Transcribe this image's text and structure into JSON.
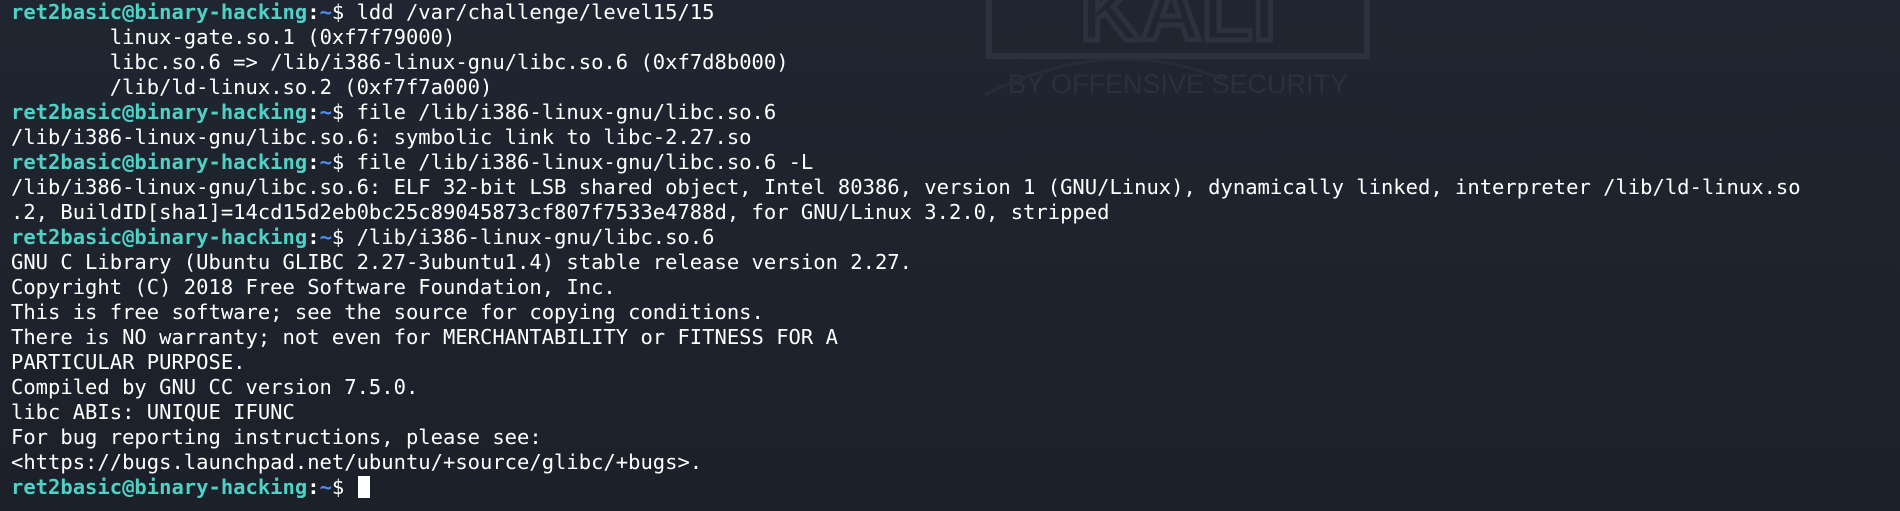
{
  "colors": {
    "background": "#1d222b",
    "prompt_userhost": "#4fd1c5",
    "prompt_path": "#4b8df0",
    "text": "#ffffff"
  },
  "watermark": {
    "logo_text": "KALI",
    "tagline": "BY OFFENSIVE SECURITY"
  },
  "prompt": {
    "userhost": "ret2basic@binary-hacking",
    "separator": ":",
    "path": "~",
    "sign": "$ "
  },
  "lines": [
    {
      "type": "prompt",
      "command": "ldd /var/challenge/level15/15"
    },
    {
      "type": "output",
      "text": "\tlinux-gate.so.1 (0xf7f79000)"
    },
    {
      "type": "output",
      "text": "\tlibc.so.6 => /lib/i386-linux-gnu/libc.so.6 (0xf7d8b000)"
    },
    {
      "type": "output",
      "text": "\t/lib/ld-linux.so.2 (0xf7f7a000)"
    },
    {
      "type": "prompt",
      "command": "file /lib/i386-linux-gnu/libc.so.6"
    },
    {
      "type": "output",
      "text": "/lib/i386-linux-gnu/libc.so.6: symbolic link to libc-2.27.so"
    },
    {
      "type": "prompt",
      "command": "file /lib/i386-linux-gnu/libc.so.6 -L"
    },
    {
      "type": "output",
      "text": "/lib/i386-linux-gnu/libc.so.6: ELF 32-bit LSB shared object, Intel 80386, version 1 (GNU/Linux), dynamically linked, interpreter /lib/ld-linux.so"
    },
    {
      "type": "output",
      "text": ".2, BuildID[sha1]=14cd15d2eb0bc25c89045873cf807f7533e4788d, for GNU/Linux 3.2.0, stripped"
    },
    {
      "type": "prompt",
      "command": "/lib/i386-linux-gnu/libc.so.6"
    },
    {
      "type": "output",
      "text": "GNU C Library (Ubuntu GLIBC 2.27-3ubuntu1.4) stable release version 2.27."
    },
    {
      "type": "output",
      "text": "Copyright (C) 2018 Free Software Foundation, Inc."
    },
    {
      "type": "output",
      "text": "This is free software; see the source for copying conditions."
    },
    {
      "type": "output",
      "text": "There is NO warranty; not even for MERCHANTABILITY or FITNESS FOR A"
    },
    {
      "type": "output",
      "text": "PARTICULAR PURPOSE."
    },
    {
      "type": "output",
      "text": "Compiled by GNU CC version 7.5.0."
    },
    {
      "type": "output",
      "text": "libc ABIs: UNIQUE IFUNC"
    },
    {
      "type": "output",
      "text": "For bug reporting instructions, please see:"
    },
    {
      "type": "output",
      "text": "<https://bugs.launchpad.net/ubuntu/+source/glibc/+bugs>."
    },
    {
      "type": "prompt",
      "command": "",
      "cursor": true
    }
  ]
}
